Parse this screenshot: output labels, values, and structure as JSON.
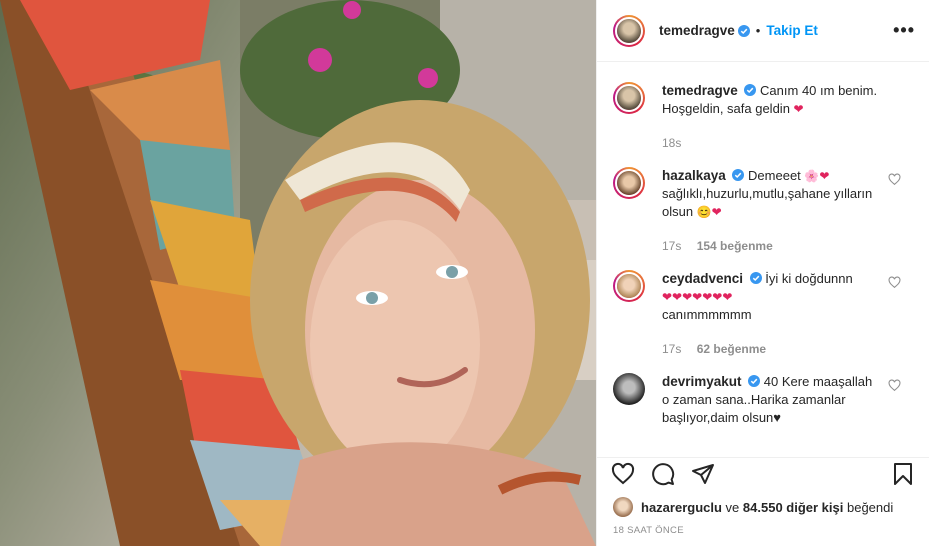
{
  "post": {
    "photo_alt": "",
    "author": "temedragve",
    "follow_label": "Takip Et",
    "separator": "•",
    "more_label": "•••"
  },
  "caption": {
    "user": "temedragve",
    "text": "Canım 40 ım benim. Hoşgeldin, safa geldin",
    "emoji": "❤",
    "time": "18s"
  },
  "comments": [
    {
      "user": "hazalkaya",
      "text": "Demeeet",
      "emoji": "🌸❤",
      "text2": "sağlıklı,huzurlu,mutlu,şahane yılların olsun",
      "emoji2": "😊❤",
      "time": "17s",
      "likes": "154 beğenme"
    },
    {
      "user": "ceydadvenci",
      "text": "İyi ki doğdunnn",
      "emoji": "❤❤❤❤❤❤❤",
      "text2": "canımmmmmm",
      "time": "17s",
      "likes": "62 beğenme"
    },
    {
      "user": "devrimyakut",
      "text": "40 Kere maaşallah o zaman sana..Harika zamanlar başlıyor,daim olsun♥"
    }
  ],
  "likes_row": {
    "liker": "hazarerguclu",
    "connector": "ve",
    "others": "84.550 diğer kişi",
    "suffix": "beğendi"
  },
  "timestamp": "18 SAAT ÖNCE",
  "colors": {
    "accent": "#0095f6",
    "verified": "#3897f0",
    "heart": "#ed4956",
    "muted": "#8e8e8e"
  }
}
